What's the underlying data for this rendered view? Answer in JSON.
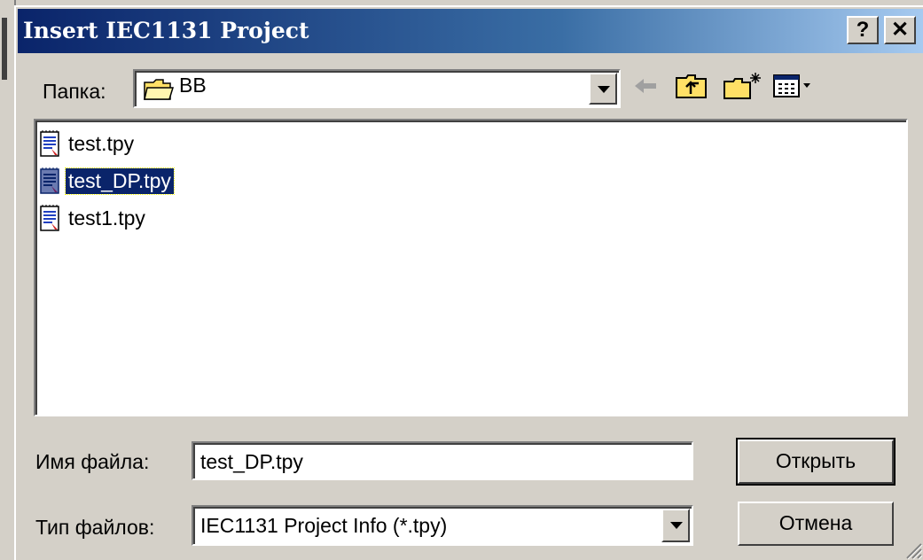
{
  "dialog": {
    "title": "Insert IEC1131 Project",
    "help_label": "?",
    "close_label": "✕"
  },
  "folder": {
    "label": "Папка:",
    "value": "BB"
  },
  "toolbar": {
    "icons": [
      "back-arrow-icon",
      "up-folder-icon",
      "new-folder-icon",
      "view-menu-icon"
    ]
  },
  "files": [
    {
      "name": "test.tpy",
      "selected": false
    },
    {
      "name": "test_DP.tpy",
      "selected": true
    },
    {
      "name": "test1.tpy",
      "selected": false
    }
  ],
  "filename": {
    "label": "Имя файла:",
    "value": "test_DP.tpy"
  },
  "filetype": {
    "label": "Тип файлов:",
    "value": "IEC1131 Project Info (*.tpy)"
  },
  "buttons": {
    "open": "Открыть",
    "cancel": "Отмена"
  },
  "colors": {
    "title_start": "#0a246a",
    "title_end": "#a6caf0",
    "selection": "#0a246a",
    "face": "#d4d0c8"
  }
}
